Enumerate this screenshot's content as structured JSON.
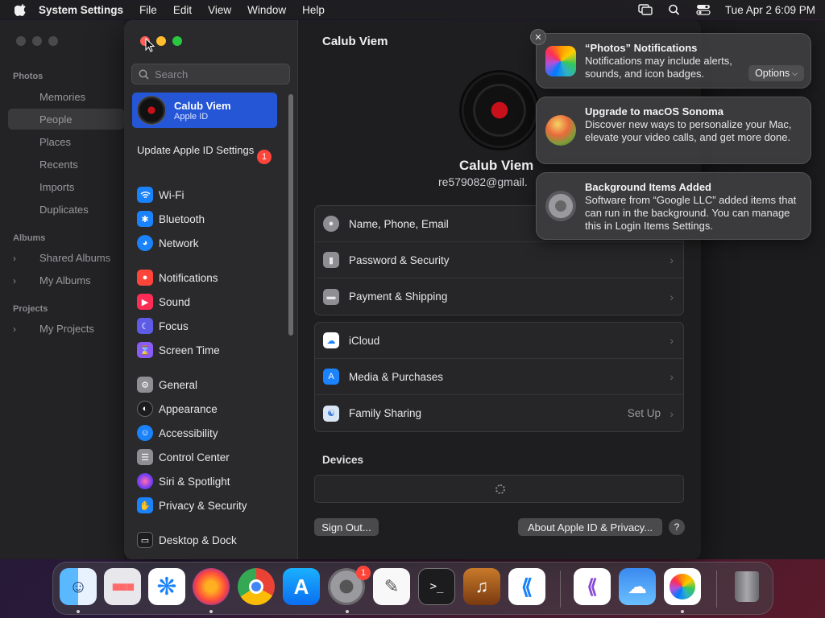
{
  "menubar": {
    "app": "System Settings",
    "items": [
      "File",
      "Edit",
      "View",
      "Window",
      "Help"
    ],
    "clock": "Tue Apr 2  6:09 PM"
  },
  "photos": {
    "sections": {
      "photos": "Photos",
      "albums": "Albums",
      "projects": "Projects"
    },
    "items": {
      "memories": "Memories",
      "people": "People",
      "places": "Places",
      "recents": "Recents",
      "imports": "Imports",
      "duplicates": "Duplicates",
      "shared_albums": "Shared Albums",
      "my_albums": "My Albums",
      "my_projects": "My Projects"
    }
  },
  "sidebar": {
    "search_placeholder": "Search",
    "apple_id": {
      "name": "Calub Viem",
      "sub": "Apple ID"
    },
    "update_label": "Update Apple ID Settings",
    "update_badge": "1",
    "items": [
      {
        "label": "Wi-Fi",
        "color": "#1a82fb"
      },
      {
        "label": "Bluetooth",
        "color": "#1a82fb"
      },
      {
        "label": "Network",
        "color": "#1a82fb"
      },
      {
        "label": "Notifications",
        "color": "#ff453a"
      },
      {
        "label": "Sound",
        "color": "#ff2d55"
      },
      {
        "label": "Focus",
        "color": "#5e5ce6"
      },
      {
        "label": "Screen Time",
        "color": "#8a5cf6"
      },
      {
        "label": "General",
        "color": "#8e8e93"
      },
      {
        "label": "Appearance",
        "color": "#1c1c1e"
      },
      {
        "label": "Accessibility",
        "color": "#1a82fb"
      },
      {
        "label": "Control Center",
        "color": "#8e8e93"
      },
      {
        "label": "Siri & Spotlight",
        "color": "#b43cd4"
      },
      {
        "label": "Privacy & Security",
        "color": "#1a82fb"
      },
      {
        "label": "Desktop & Dock",
        "color": "#1c1c1e"
      }
    ]
  },
  "main": {
    "title": "Calub Viem",
    "user_name": "Calub Viem",
    "user_email": "re579082@gmail.",
    "group1": [
      {
        "label": "Name, Phone, Email"
      },
      {
        "label": "Password & Security"
      },
      {
        "label": "Payment & Shipping"
      }
    ],
    "group2": [
      {
        "label": "iCloud"
      },
      {
        "label": "Media & Purchases"
      },
      {
        "label": "Family Sharing",
        "value": "Set Up"
      }
    ],
    "devices_heading": "Devices",
    "sign_out": "Sign Out...",
    "about": "About Apple ID & Privacy...",
    "help": "?"
  },
  "notifications": [
    {
      "title": "“Photos” Notifications",
      "body": "Notifications may include alerts, sounds, and icon badges.",
      "action": "Options"
    },
    {
      "title": "Upgrade to macOS Sonoma",
      "body": "Discover new ways to personalize your Mac, elevate your video calls, and get more done."
    },
    {
      "title": "Background Items Added",
      "body": "Software from “Google LLC” added items that can run in the background. You can manage this in Login Items Settings."
    }
  ],
  "dock": {
    "settings_badge": "1"
  }
}
